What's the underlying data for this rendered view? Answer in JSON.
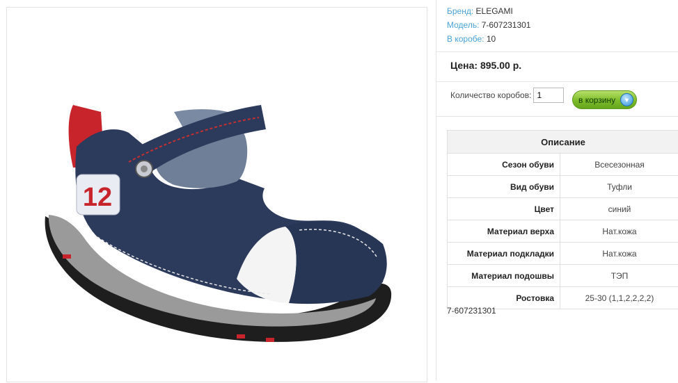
{
  "product": {
    "image_alt": "children's sandal",
    "brand_label": "Бренд:",
    "brand_value": "ELEGAMI",
    "model_label": "Модель:",
    "model_value": "7-607231301",
    "box_label": "В коробе:",
    "box_value": "10",
    "price": "Цена: 895.00 р.",
    "qty_label": "Количество коробов:",
    "qty_value": "1",
    "cart_button": "в корзину",
    "article_code": "7-607231301"
  },
  "description": {
    "title": "Описание",
    "rows": [
      {
        "key": "Сезон обуви",
        "value": "Всесезонная"
      },
      {
        "key": "Вид обуви",
        "value": "Туфли"
      },
      {
        "key": "Цвет",
        "value": "синий"
      },
      {
        "key": "Материал верха",
        "value": "Нат.кожа"
      },
      {
        "key": "Материал подкладки",
        "value": "Нат.кожа"
      },
      {
        "key": "Материал подошвы",
        "value": "ТЭП"
      },
      {
        "key": "Ростовка",
        "value": "25-30 (1,1,2,2,2,2)"
      }
    ]
  },
  "colors": {
    "label_blue": "#4aa3d8",
    "button_green": "#7cbc2a",
    "shoe_navy": "#2c3a5c",
    "shoe_red": "#c8242c"
  }
}
